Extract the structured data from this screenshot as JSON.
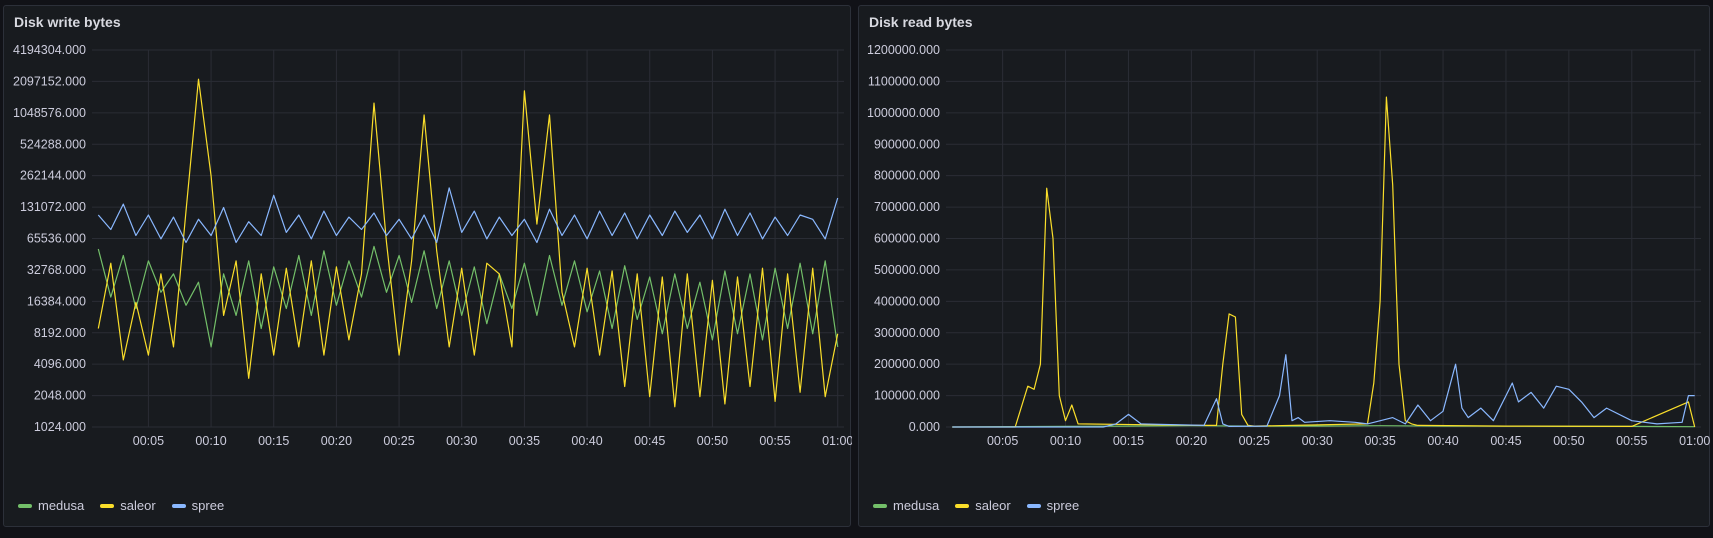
{
  "colors": {
    "medusa": "#73bf69",
    "saleor": "#fade2a",
    "spree": "#8ab8ff",
    "grid": "#2a2d35"
  },
  "chart_data": [
    {
      "type": "line",
      "title": "Disk write bytes",
      "yscale": "log2",
      "ylim": [
        1024,
        4194304
      ],
      "y_ticks": [
        "4194304.000",
        "2097152.000",
        "1048576.000",
        "524288.000",
        "262144.000",
        "131072.000",
        "65536.000",
        "32768.000",
        "16384.000",
        "8192.000",
        "4096.000",
        "2048.000",
        "1024.000"
      ],
      "x_ticks": [
        "00:05",
        "00:10",
        "00:15",
        "00:20",
        "00:25",
        "00:30",
        "00:35",
        "00:40",
        "00:45",
        "00:50",
        "00:55",
        "01:00"
      ],
      "x_range_minutes": [
        0.5,
        60.5
      ],
      "series": [
        {
          "name": "medusa",
          "x": [
            1,
            2,
            3,
            4,
            5,
            6,
            7,
            8,
            9,
            10,
            11,
            12,
            13,
            14,
            15,
            16,
            17,
            18,
            19,
            20,
            21,
            22,
            23,
            24,
            25,
            26,
            27,
            28,
            29,
            30,
            31,
            32,
            33,
            34,
            35,
            36,
            37,
            38,
            39,
            40,
            41,
            42,
            43,
            44,
            45,
            46,
            47,
            48,
            49,
            50,
            51,
            52,
            53,
            54,
            55,
            56,
            57,
            58,
            59,
            60
          ],
          "y": [
            52000,
            18000,
            45000,
            14000,
            40000,
            20000,
            30000,
            15000,
            25000,
            6000,
            30000,
            12000,
            40000,
            9000,
            35000,
            14000,
            45000,
            12000,
            50000,
            15000,
            40000,
            18000,
            55000,
            20000,
            45000,
            16000,
            50000,
            14000,
            40000,
            12000,
            35000,
            10000,
            30000,
            14000,
            38000,
            12000,
            45000,
            15000,
            40000,
            13000,
            32000,
            9000,
            36000,
            11000,
            28000,
            8000,
            30000,
            9000,
            25000,
            7000,
            32000,
            8000,
            30000,
            7000,
            34000,
            9000,
            38000,
            8000,
            40000,
            6000
          ]
        },
        {
          "name": "saleor",
          "x": [
            1,
            2,
            3,
            4,
            5,
            6,
            7,
            8,
            9,
            10,
            11,
            12,
            13,
            14,
            15,
            16,
            17,
            18,
            19,
            20,
            21,
            22,
            23,
            24,
            25,
            26,
            27,
            28,
            29,
            30,
            31,
            32,
            33,
            34,
            35,
            36,
            37,
            38,
            39,
            40,
            41,
            42,
            43,
            44,
            45,
            46,
            47,
            48,
            49,
            50,
            51,
            52,
            53,
            54,
            55,
            56,
            57,
            58,
            59,
            60
          ],
          "y": [
            9000,
            38000,
            4500,
            16000,
            5000,
            30000,
            6000,
            120000,
            2200000,
            260000,
            12000,
            40000,
            3000,
            30000,
            5000,
            34000,
            6000,
            40000,
            5000,
            35000,
            7000,
            30000,
            1300000,
            60000,
            5000,
            40000,
            1000000,
            50000,
            6000,
            34000,
            5000,
            38000,
            30000,
            6000,
            1700000,
            90000,
            1000000,
            20000,
            6000,
            34000,
            5000,
            32000,
            2500,
            30000,
            2000,
            28000,
            1600,
            30000,
            2000,
            26000,
            1700,
            28000,
            2500,
            34000,
            1800,
            30000,
            2200,
            34000,
            2000,
            8000
          ]
        },
        {
          "name": "spree",
          "x": [
            1,
            2,
            3,
            4,
            5,
            6,
            7,
            8,
            9,
            10,
            11,
            12,
            13,
            14,
            15,
            16,
            17,
            18,
            19,
            20,
            21,
            22,
            23,
            24,
            25,
            26,
            27,
            28,
            29,
            30,
            31,
            32,
            33,
            34,
            35,
            36,
            37,
            38,
            39,
            40,
            41,
            42,
            43,
            44,
            45,
            46,
            47,
            48,
            49,
            50,
            51,
            52,
            53,
            54,
            55,
            56,
            57,
            58,
            59,
            60
          ],
          "y": [
            110000,
            80000,
            140000,
            70000,
            110000,
            65000,
            105000,
            60000,
            100000,
            70000,
            130000,
            60000,
            95000,
            70000,
            170000,
            75000,
            110000,
            65000,
            120000,
            70000,
            105000,
            80000,
            115000,
            70000,
            100000,
            65000,
            110000,
            60000,
            200000,
            75000,
            120000,
            65000,
            105000,
            70000,
            100000,
            60000,
            125000,
            70000,
            110000,
            65000,
            120000,
            70000,
            115000,
            65000,
            110000,
            70000,
            120000,
            75000,
            110000,
            65000,
            125000,
            70000,
            115000,
            65000,
            105000,
            70000,
            110000,
            100000,
            65000,
            160000
          ]
        }
      ]
    },
    {
      "type": "line",
      "title": "Disk read bytes",
      "ylim": [
        0,
        1200000
      ],
      "y_ticks": [
        "1200000.000",
        "1100000.000",
        "1000000.000",
        "900000.000",
        "800000.000",
        "700000.000",
        "600000.000",
        "500000.000",
        "400000.000",
        "300000.000",
        "200000.000",
        "100000.000",
        "0.000"
      ],
      "x_ticks": [
        "00:05",
        "00:10",
        "00:15",
        "00:20",
        "00:25",
        "00:30",
        "00:35",
        "00:40",
        "00:45",
        "00:50",
        "00:55",
        "01:00"
      ],
      "x_range_minutes": [
        0.5,
        60.5
      ],
      "series": [
        {
          "name": "medusa",
          "x": [
            1,
            10,
            15,
            20,
            25,
            30,
            35,
            40,
            45,
            50,
            55,
            60
          ],
          "y": [
            0,
            2000,
            3000,
            4000,
            3000,
            3000,
            4000,
            3000,
            3000,
            2000,
            2000,
            1000
          ]
        },
        {
          "name": "saleor",
          "x": [
            1,
            6,
            7,
            7.5,
            8,
            8.5,
            9,
            9.5,
            10,
            10.5,
            11,
            21,
            22,
            22.5,
            23,
            23.5,
            24,
            24.5,
            25,
            34,
            34.5,
            35,
            35.5,
            36,
            36.5,
            37,
            37.5,
            38,
            45,
            55,
            59.5,
            60
          ],
          "y": [
            0,
            0,
            130000,
            120000,
            200000,
            760000,
            600000,
            100000,
            20000,
            70000,
            10000,
            5000,
            5000,
            200000,
            360000,
            350000,
            40000,
            5000,
            3000,
            10000,
            140000,
            400000,
            1050000,
            770000,
            200000,
            20000,
            10000,
            5000,
            3000,
            2000,
            80000,
            0
          ]
        },
        {
          "name": "spree",
          "x": [
            1,
            13,
            14,
            15,
            16,
            21,
            22,
            22.5,
            23,
            26,
            27,
            27.5,
            28,
            28.5,
            29,
            31,
            33,
            34,
            36,
            37,
            38,
            39,
            40,
            41,
            41.5,
            42,
            43,
            44,
            45,
            45.5,
            46,
            47,
            48,
            49,
            50,
            51,
            52,
            53,
            55,
            57,
            59,
            59.5,
            60
          ],
          "y": [
            0,
            0,
            10000,
            40000,
            10000,
            5000,
            90000,
            10000,
            2000,
            3000,
            100000,
            230000,
            20000,
            30000,
            15000,
            20000,
            15000,
            10000,
            30000,
            10000,
            70000,
            20000,
            50000,
            200000,
            60000,
            30000,
            60000,
            20000,
            100000,
            140000,
            80000,
            110000,
            60000,
            130000,
            120000,
            80000,
            30000,
            60000,
            20000,
            10000,
            15000,
            100000,
            100000
          ]
        }
      ]
    }
  ]
}
